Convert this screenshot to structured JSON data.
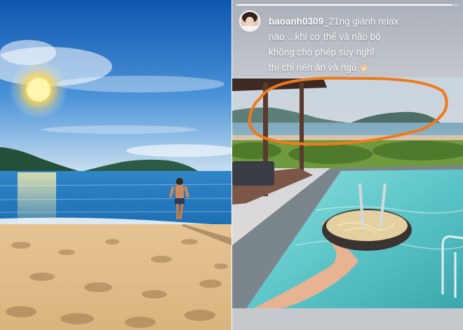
{
  "story": {
    "username": "baoanh0309",
    "caption_lines": [
      "_21ng giành relax",
      "nào ...khi cơ thể và não bộ",
      "không cho phép suy nghĩ",
      "thì chỉ nên ăn và ngủ"
    ],
    "progress": 0.97,
    "emoji_icon": "clapping-hands-icon"
  },
  "colors": {
    "annotation_circle": "#f07a1a",
    "sky_top": "#1560b8",
    "sand": "#e7c79a",
    "pool": "#5ec6c9"
  }
}
